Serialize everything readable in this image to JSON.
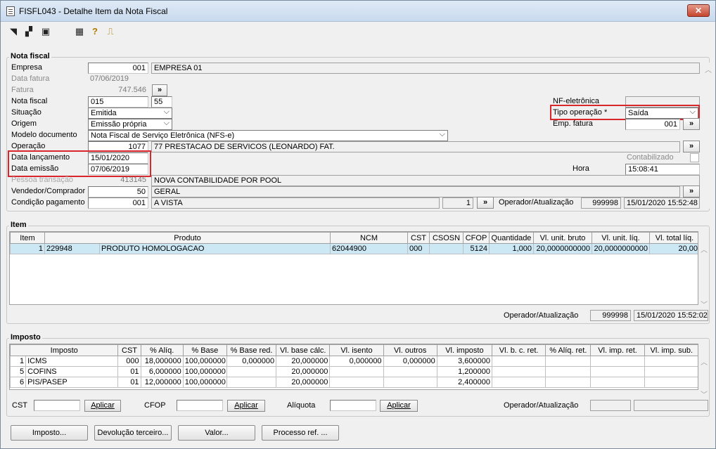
{
  "window": {
    "title": "FISFL043 - Detalhe Item da Nota Fiscal",
    "close_label": "✕"
  },
  "nota": {
    "group_title": "Nota fiscal",
    "empresa_label": "Empresa",
    "empresa_code": "001",
    "empresa_name": "EMPRESA 01",
    "data_fatura_label": "Data fatura",
    "data_fatura": "07/06/2019",
    "fatura_label": "Fatura",
    "fatura": "747.546",
    "fatura_btn": "»",
    "nota_fiscal_label": "Nota fiscal",
    "nota_fiscal": "015",
    "serie": "55",
    "situacao_label": "Situação",
    "situacao": "Emitida",
    "origem_label": "Origem",
    "origem": "Emissão própria",
    "modelo_label": "Modelo documento",
    "modelo": "Nota Fiscal de Serviço Eletrônica (NFS-e)",
    "operacao_label": "Operação",
    "operacao_code": "1077",
    "operacao_name": "77 PRESTACAO DE SERVICOS (LEONARDO) FAT.",
    "operacao_btn": "»",
    "data_lanc_label": "Data lançamento",
    "data_lanc": "15/01/2020",
    "data_emis_label": "Data emissão",
    "data_emis": "07/06/2019",
    "pessoa_label": "Pessoa transação",
    "pessoa_code": "413145",
    "pessoa_name": "NOVA CONTABILIDADE POR POOL",
    "vendedor_label": "Vendedor/Comprador",
    "vendedor_code": "50",
    "vendedor_name": "GERAL",
    "vendedor_btn": "»",
    "cond_label": "Condição pagamento",
    "cond_code": "001",
    "cond_name": "A VISTA",
    "cond_num": "1",
    "cond_btn": "»",
    "nfe_label": "NF-eletrônica",
    "tipo_op_label": "Tipo operação *",
    "tipo_op": "Saída",
    "emp_fatura_label": "Emp. fatura",
    "emp_fatura": "001",
    "emp_fatura_btn": "»",
    "contabilizado_label": "Contabilizado",
    "hora_label": "Hora",
    "hora": "15:08:41",
    "operador_label": "Operador/Atualização",
    "operador": "999998",
    "atualizacao": "15/01/2020 15:52:48"
  },
  "item": {
    "group_title": "Item",
    "headers": [
      "Item",
      "Produto",
      "",
      "NCM",
      "CST",
      "CSOSN",
      "CFOP",
      "Quantidade",
      "Vl. unit. bruto",
      "Vl. unit. líq.",
      "Vl. total líq."
    ],
    "rows": [
      [
        "1",
        "229948",
        "PRODUTO HOMOLOGACAO",
        "62044900",
        "000",
        "",
        "5124",
        "1,000",
        "20,0000000000",
        "20,0000000000",
        "20,00"
      ]
    ],
    "operador_label": "Operador/Atualização",
    "operador": "999998",
    "atualizacao": "15/01/2020 15:52:02"
  },
  "imposto": {
    "group_title": "Imposto",
    "headers": [
      "Imposto",
      "CST",
      "% Alíq.",
      "% Base",
      "% Base red.",
      "Vl. base cálc.",
      "Vl. isento",
      "Vl. outros",
      "Vl. imposto",
      "Vl. b. c. ret.",
      "% Alíq. ret.",
      "Vl. imp. ret.",
      "Vl. imp. sub."
    ],
    "rows": [
      [
        "1",
        "ICMS",
        "000",
        "18,000000",
        "100,000000",
        "0,000000",
        "20,000000",
        "0,000000",
        "0,000000",
        "3,600000",
        "",
        "",
        "",
        ""
      ],
      [
        "5",
        "COFINS",
        "01",
        "6,000000",
        "100,000000",
        "",
        "20,000000",
        "",
        "",
        "1,200000",
        "",
        "",
        "",
        ""
      ],
      [
        "6",
        "PIS/PASEP",
        "01",
        "12,000000",
        "100,000000",
        "",
        "20,000000",
        "",
        "",
        "2,400000",
        "",
        "",
        "",
        ""
      ]
    ],
    "cst_label": "CST",
    "cfop_label": "CFOP",
    "aliquota_label": "Alíquota",
    "aplicar_label": "Aplicar",
    "operador_label": "Operador/Atualização"
  },
  "buttons": {
    "imposto": "Imposto...",
    "devolucao": "Devolução terceiro...",
    "valor": "Valor...",
    "processo": "Processo ref. ..."
  }
}
